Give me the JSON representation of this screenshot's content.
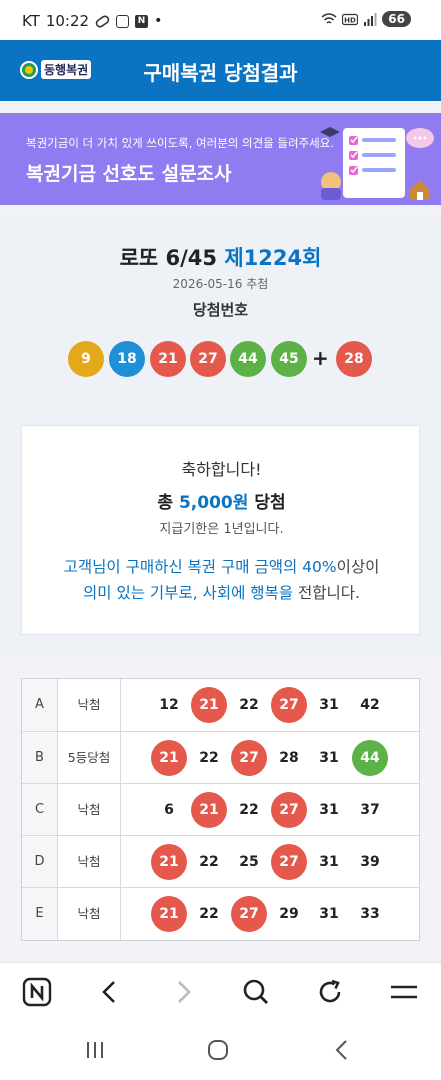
{
  "status_bar": {
    "carrier": "KT",
    "time": "10:22",
    "battery": "66"
  },
  "header": {
    "logo_text": "동행복권",
    "title": "구매복권 당첨결과"
  },
  "banner": {
    "subtitle": "복권기금이 더 가치 있게 쓰이도록, 여러분의 의견을 들려주세요.",
    "title": "복권기금 선호도 설문조사"
  },
  "draw": {
    "game_prefix": "로또 6/45",
    "round": "제1224회",
    "date": "2026-05-16 추첨",
    "numbers_label": "당첨번호",
    "numbers": [
      "9",
      "18",
      "21",
      "27",
      "44",
      "45"
    ],
    "plus": "+",
    "bonus": "28"
  },
  "prize": {
    "congrats": "축하합니다!",
    "total_prefix": "총",
    "total_amount": "5,000원",
    "total_suffix": "당첨",
    "deadline": "지급기한은 1년입니다.",
    "donate_1": "고객님이 구매하신 복권 구매 금액의 40%",
    "donate_2": "이상이",
    "donate_3": "의미 있는 기부로, 사회에 행복을",
    "donate_4": "전합니다."
  },
  "ticket": {
    "rows": [
      {
        "letter": "A",
        "result": "낙첨",
        "numbers": [
          "12",
          "21",
          "22",
          "27",
          "31",
          "42"
        ],
        "hits": [
          false,
          true,
          false,
          true,
          false,
          false
        ]
      },
      {
        "letter": "B",
        "result": "5등당첨",
        "numbers": [
          "21",
          "22",
          "27",
          "28",
          "31",
          "44"
        ],
        "hits": [
          true,
          false,
          true,
          false,
          false,
          true
        ]
      },
      {
        "letter": "C",
        "result": "낙첨",
        "numbers": [
          "6",
          "21",
          "22",
          "27",
          "31",
          "37"
        ],
        "hits": [
          false,
          true,
          false,
          true,
          false,
          false
        ]
      },
      {
        "letter": "D",
        "result": "낙첨",
        "numbers": [
          "21",
          "22",
          "25",
          "27",
          "31",
          "39"
        ],
        "hits": [
          true,
          false,
          false,
          true,
          false,
          false
        ]
      },
      {
        "letter": "E",
        "result": "낙첨",
        "numbers": [
          "21",
          "22",
          "27",
          "29",
          "31",
          "33"
        ],
        "hits": [
          true,
          false,
          true,
          false,
          false,
          false
        ]
      }
    ]
  },
  "colors": {
    "brand_blue": "#0a73c2",
    "ball_yellow": "#e4a81b",
    "ball_blue": "#1f8fd6",
    "ball_red": "#e5584c",
    "ball_green": "#5cb247",
    "banner_purple": "#8e7cf0"
  },
  "browser_bar": {
    "icons": [
      "naver-home-icon",
      "back-icon",
      "forward-icon",
      "search-icon",
      "refresh-icon",
      "menu-icon"
    ]
  },
  "system_nav": {
    "icons": [
      "recent-apps-icon",
      "home-icon",
      "back-icon"
    ]
  }
}
